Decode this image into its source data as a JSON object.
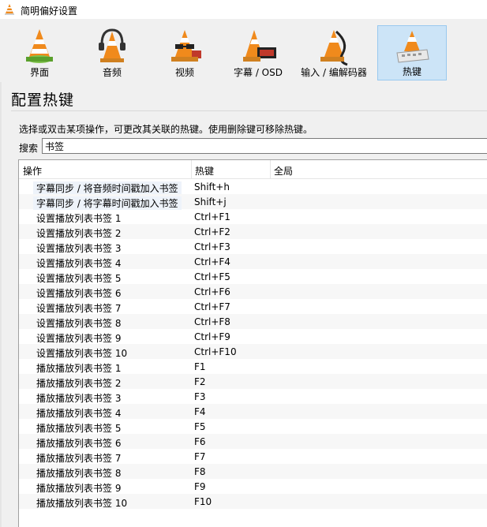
{
  "window": {
    "title": "简明偏好设置"
  },
  "toolbar": {
    "items": [
      {
        "label": "界面"
      },
      {
        "label": "音频"
      },
      {
        "label": "视频"
      },
      {
        "label": "字幕 / OSD"
      },
      {
        "label": "输入 / 编解码器"
      },
      {
        "label": "热键"
      }
    ],
    "active_index": 5
  },
  "section": {
    "title": "配置热键"
  },
  "description": "选择或双击某项操作，可更改其关联的热键。使用删除键可移除热键。",
  "search": {
    "label": "搜索",
    "value": "书签"
  },
  "table": {
    "columns": [
      "操作",
      "热键",
      "全局"
    ],
    "rows": [
      {
        "action": "字幕同步 / 将音频时间戳加入书签",
        "key": "Shift+h",
        "global": ""
      },
      {
        "action": "字幕同步 / 将字幕时间戳加入书签",
        "key": "Shift+j",
        "global": ""
      },
      {
        "action": "设置播放列表书签 1",
        "key": "Ctrl+F1",
        "global": ""
      },
      {
        "action": "设置播放列表书签 2",
        "key": "Ctrl+F2",
        "global": ""
      },
      {
        "action": "设置播放列表书签 3",
        "key": "Ctrl+F3",
        "global": ""
      },
      {
        "action": "设置播放列表书签 4",
        "key": "Ctrl+F4",
        "global": ""
      },
      {
        "action": "设置播放列表书签 5",
        "key": "Ctrl+F5",
        "global": ""
      },
      {
        "action": "设置播放列表书签 6",
        "key": "Ctrl+F6",
        "global": ""
      },
      {
        "action": "设置播放列表书签 7",
        "key": "Ctrl+F7",
        "global": ""
      },
      {
        "action": "设置播放列表书签 8",
        "key": "Ctrl+F8",
        "global": ""
      },
      {
        "action": "设置播放列表书签 9",
        "key": "Ctrl+F9",
        "global": ""
      },
      {
        "action": "设置播放列表书签 10",
        "key": "Ctrl+F10",
        "global": ""
      },
      {
        "action": "播放播放列表书签 1",
        "key": "F1",
        "global": ""
      },
      {
        "action": "播放播放列表书签 2",
        "key": "F2",
        "global": ""
      },
      {
        "action": "播放播放列表书签 3",
        "key": "F3",
        "global": ""
      },
      {
        "action": "播放播放列表书签 4",
        "key": "F4",
        "global": ""
      },
      {
        "action": "播放播放列表书签 5",
        "key": "F5",
        "global": ""
      },
      {
        "action": "播放播放列表书签 6",
        "key": "F6",
        "global": ""
      },
      {
        "action": "播放播放列表书签 7",
        "key": "F7",
        "global": ""
      },
      {
        "action": "播放播放列表书签 8",
        "key": "F8",
        "global": ""
      },
      {
        "action": "播放播放列表书签 9",
        "key": "F9",
        "global": ""
      },
      {
        "action": "播放播放列表书签 10",
        "key": "F10",
        "global": ""
      }
    ]
  },
  "colors": {
    "accent": "#cce4f7",
    "cone_orange": "#f08a1c"
  }
}
